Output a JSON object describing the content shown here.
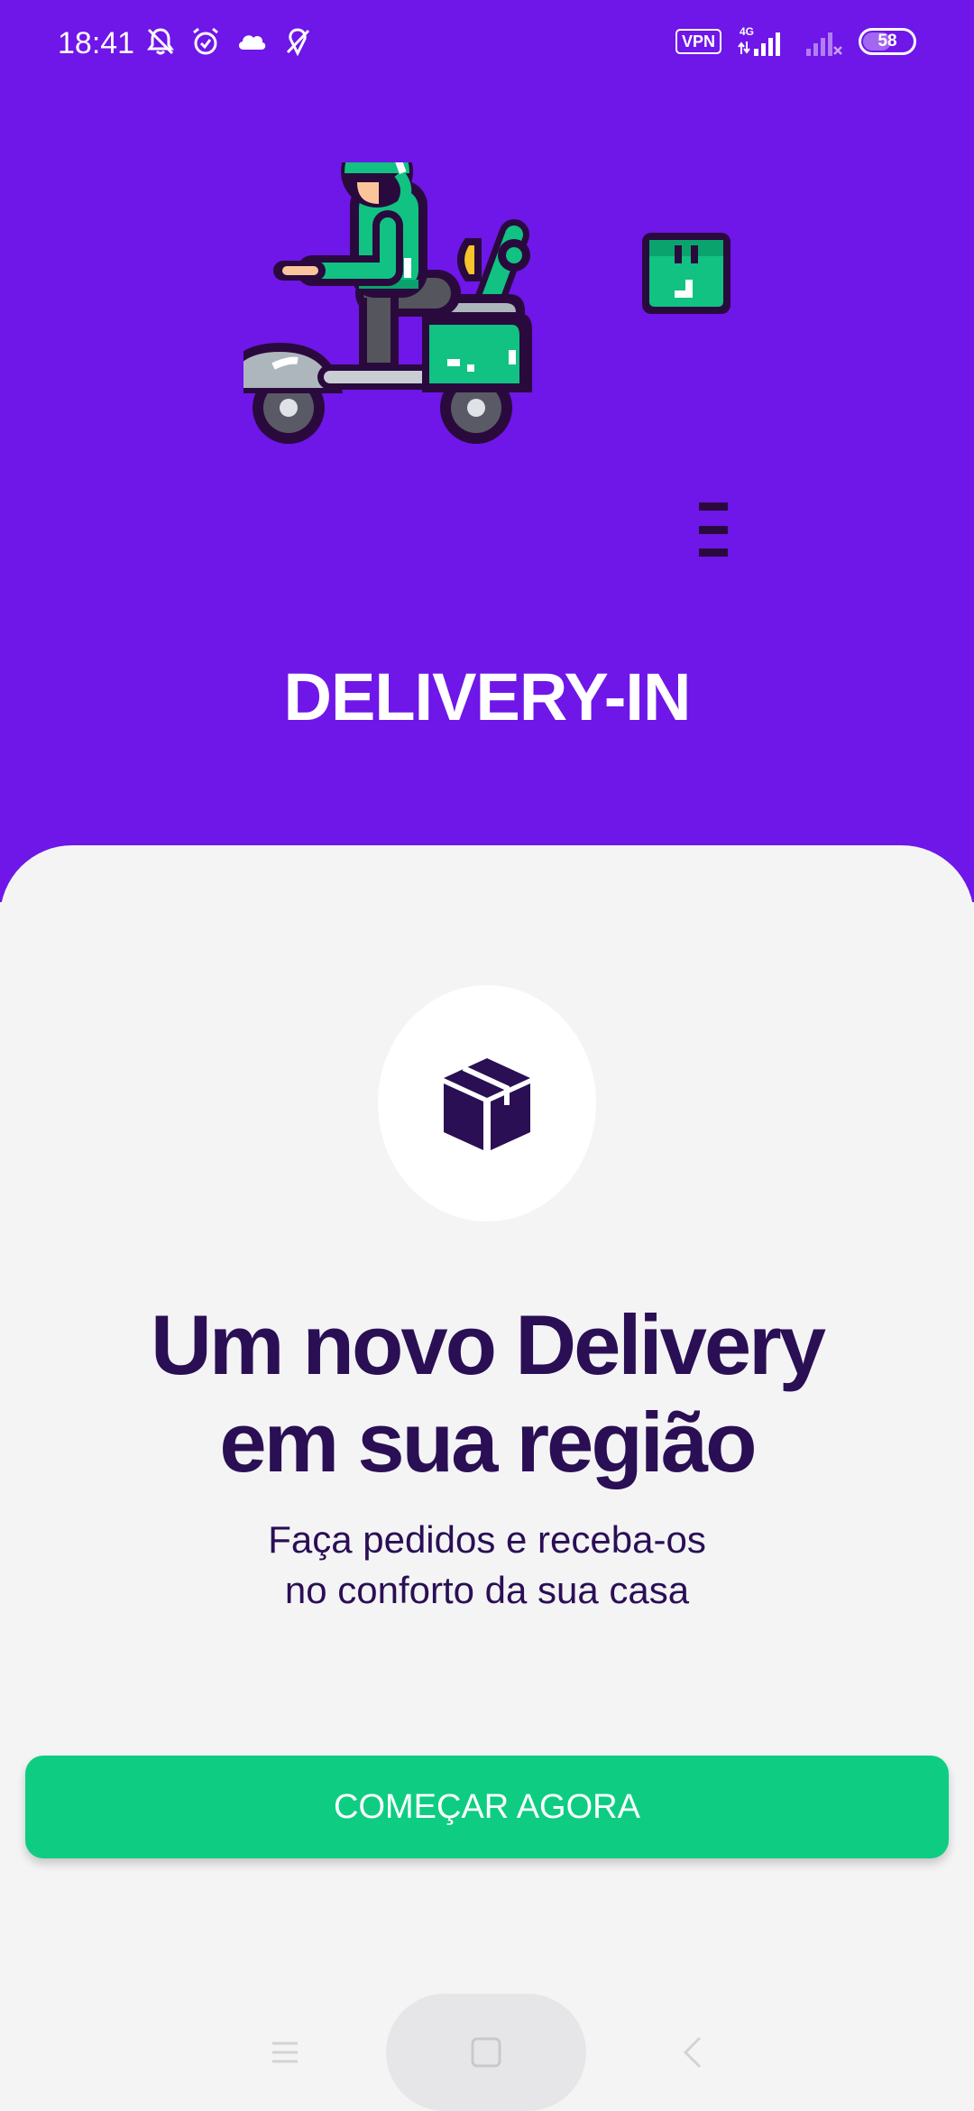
{
  "status_bar": {
    "time": "18:41",
    "vpn": "VPN",
    "network_type": "4G",
    "battery": "58",
    "battery_level": 0.58,
    "icons": [
      "mute-bell-icon",
      "alarm-icon",
      "cloud-icon",
      "location-off-icon",
      "vpn-icon",
      "signal-4g-icon",
      "signal-no-service-icon",
      "battery-icon"
    ]
  },
  "header": {
    "brand": "DELIVERY-IN",
    "illustration": "delivery-scooter-illustration",
    "background_color": "#6f16e8"
  },
  "onboarding": {
    "feature_icon": "package-box-icon",
    "headline_line1": "Um novo Delivery",
    "headline_line2": "em sua região",
    "subtitle_line1": "Faça pedidos e receba-os",
    "subtitle_line2": "no conforto da sua casa",
    "cta_label": "COMEÇAR AGORA",
    "cta_color": "#0ecd82",
    "text_color": "#2a0f55"
  },
  "nav_bar": {
    "icons": [
      "menu-recents-icon",
      "home-square-icon",
      "back-chevron-icon"
    ]
  }
}
